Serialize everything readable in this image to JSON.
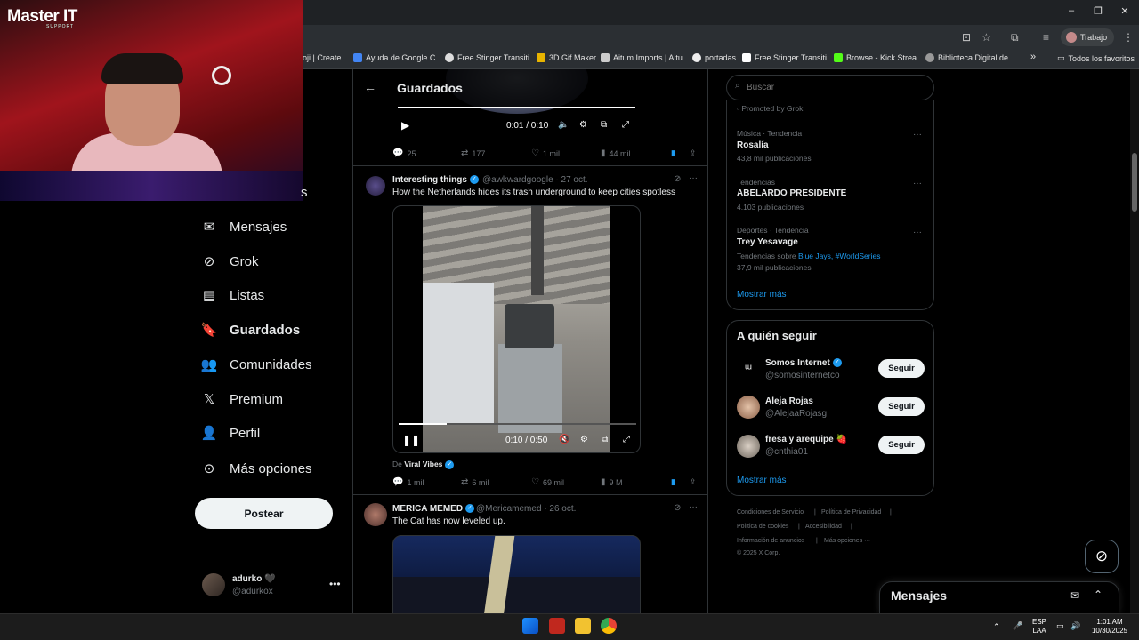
{
  "browser": {
    "profile_label": "Trabajo",
    "bookmarks": [
      "oji | Create...",
      "Ayuda de Google C...",
      "Free Stinger Transiti...",
      "3D Gif Maker",
      "Aitum Imports | Aitu...",
      "portadas",
      "Free Stinger Transiti...",
      "Browse - Kick Strea...",
      "Biblioteca Digital de...",
      "»",
      "Todos los favoritos"
    ]
  },
  "overlay": {
    "brand": "Master IT",
    "brand_sub": "SUPPORT"
  },
  "nav": {
    "items": [
      "Mensajes",
      "Grok",
      "Listas",
      "Guardados",
      "Comunidades",
      "Premium",
      "Perfil",
      "Más opciones"
    ],
    "post_button": "Postear",
    "account_name": "adurko 🖤",
    "account_handle": "@adurkox",
    "partial_label": "s"
  },
  "feed": {
    "title": "Guardados",
    "tweets": [
      {
        "video_time": "0:01 / 0:10",
        "replies": "25",
        "reposts": "177",
        "likes": "1 mil",
        "views": "44 mil"
      },
      {
        "name": "Interesting things",
        "handle": "@awkwardgoogle · 27 oct.",
        "text": "How the Netherlands hides its trash underground to keep cities spotless",
        "video_time": "0:10 / 0:50",
        "from_label": "De",
        "from_name": "Viral Vibes",
        "replies": "1 mil",
        "reposts": "6 mil",
        "likes": "69 mil",
        "views": "9 M"
      },
      {
        "name": "MERICA MEMED",
        "handle": "@Mericamemed · 26 oct.",
        "text": "The Cat has now leveled up."
      }
    ]
  },
  "sidebar": {
    "search_placeholder": "Buscar",
    "promoted": "Promoted by Grok",
    "trends": [
      {
        "category": "Música · Tendencia",
        "name": "Rosalía",
        "count": "43,8 mil publicaciones"
      },
      {
        "category": "Tendencias",
        "name": "ABELARDO PRESIDENTE",
        "count": "4.103 publicaciones"
      },
      {
        "category": "Deportes · Tendencia",
        "name": "Trey Yesavage",
        "count_prefix": "Tendencias sobre",
        "count_links": "Blue Jays, #WorldSeries",
        "count": "37,9 mil publicaciones"
      }
    ],
    "show_more": "Mostrar más",
    "who_to_follow_title": "A quién seguir",
    "follow": [
      {
        "name": "Somos Internet",
        "handle": "@somosinternetco",
        "button": "Seguir"
      },
      {
        "name": "Aleja Rojas",
        "handle": "@AlejaaRojasg",
        "button": "Seguir"
      },
      {
        "name": "fresa y arequipe 🍓",
        "handle": "@cnthia01",
        "button": "Seguir"
      }
    ],
    "follow_show_more": "Mostrar más",
    "footer": [
      "Condiciones de Servicio",
      "|",
      "Política de Privacidad",
      "|",
      "Política de cookies",
      "|",
      "Accesibilidad",
      "|",
      "Información de anuncios",
      "|",
      "Más opciones ···",
      "© 2025 X Corp."
    ]
  },
  "messages_drawer": {
    "title": "Mensajes"
  },
  "taskbar": {
    "lang": "ESP",
    "lang2": "LAA",
    "time": "1:01 AM",
    "date": "10/30/2025"
  }
}
